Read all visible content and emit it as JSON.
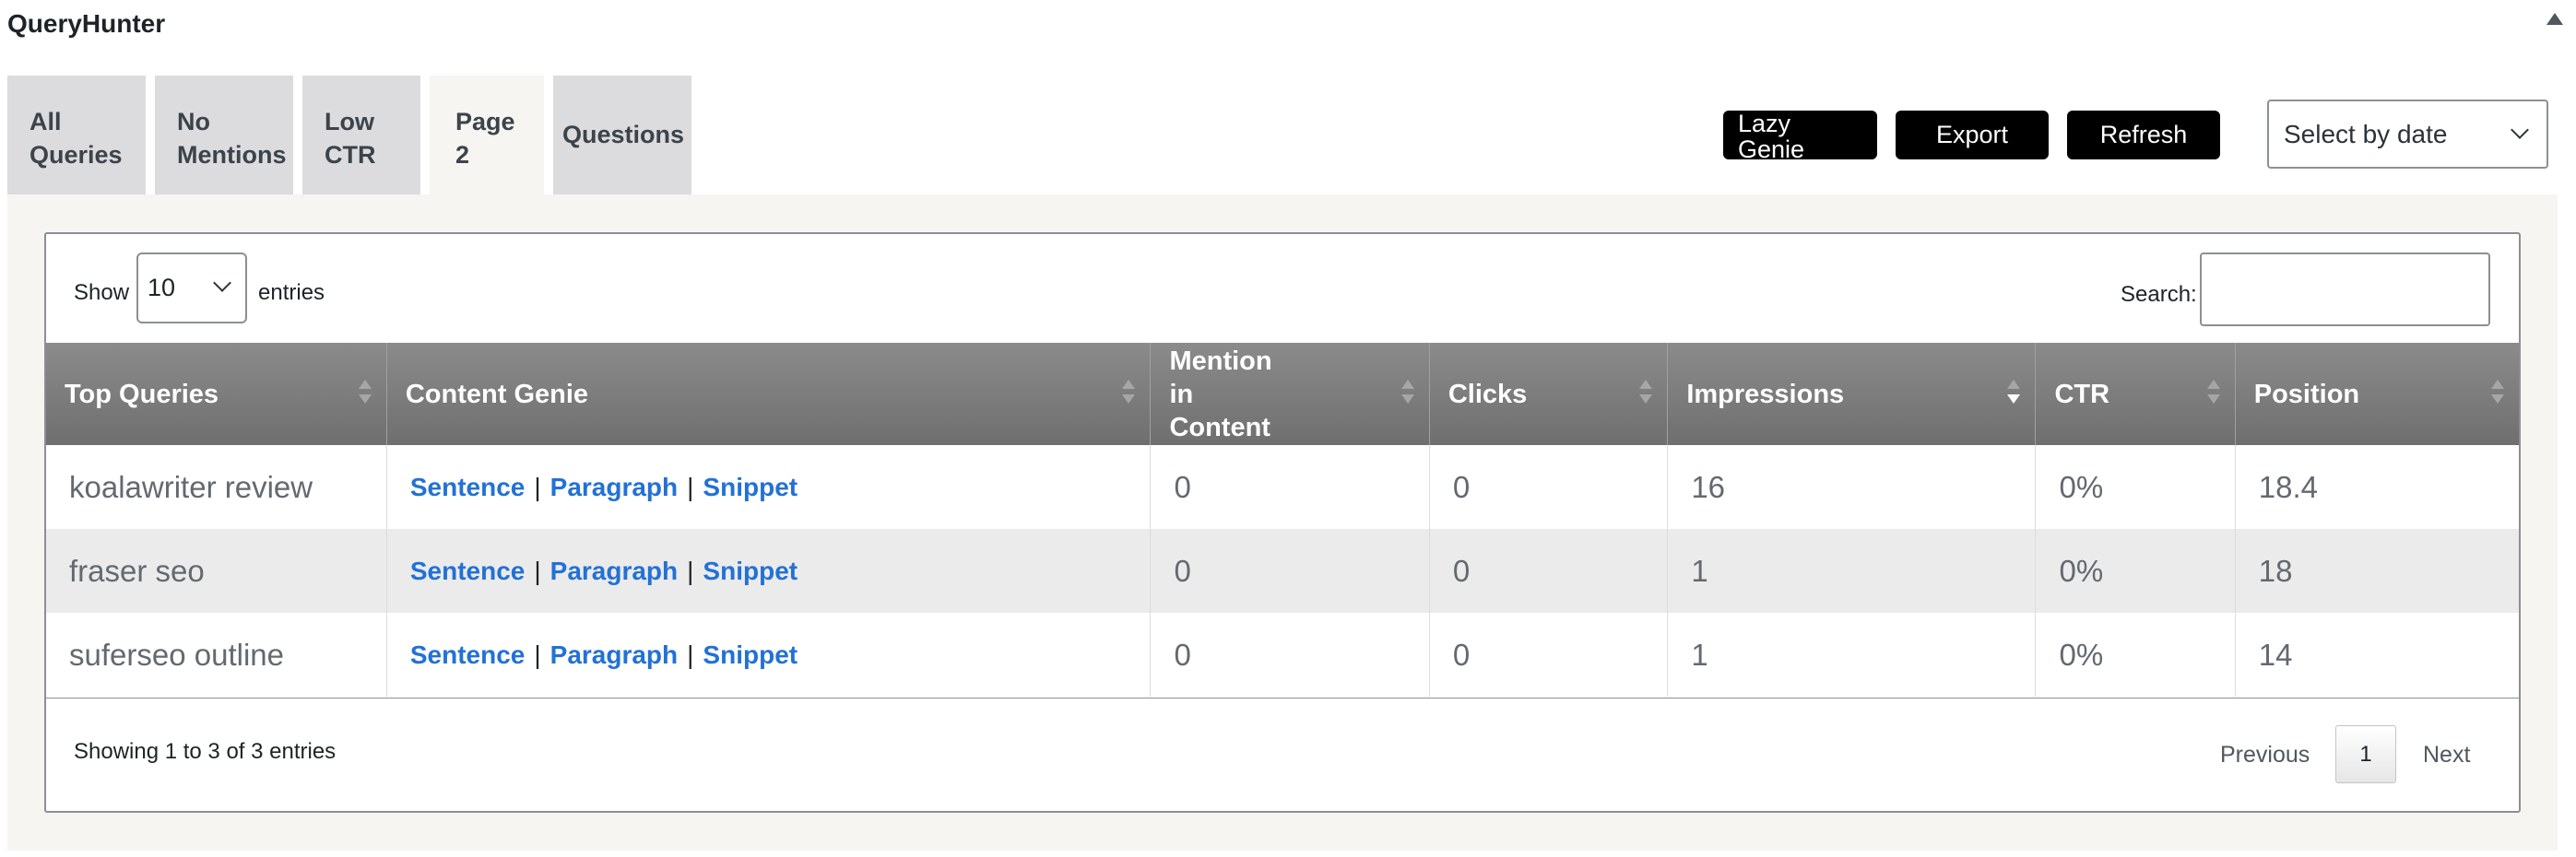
{
  "app": {
    "title": "QueryHunter"
  },
  "tabs": [
    {
      "label": "All Queries"
    },
    {
      "label": "No Mentions"
    },
    {
      "label": "Low CTR"
    },
    {
      "label": "Page 2",
      "active": true
    },
    {
      "label": "Questions"
    }
  ],
  "toolbar": {
    "lazy_genie_label": "Lazy Genie",
    "export_label": "Export",
    "refresh_label": "Refresh",
    "date_select_value": "Select by date"
  },
  "table_controls": {
    "show_label": "Show",
    "entries_value": "10",
    "entries_label": "entries",
    "search_label": "Search:",
    "search_value": ""
  },
  "columns": [
    "Top Queries",
    "Content Genie",
    "Mention in Content",
    "Clicks",
    "Impressions",
    "CTR",
    "Position"
  ],
  "rows": [
    {
      "query": "koalawriter review",
      "links": [
        "Sentence",
        "Paragraph",
        "Snippet"
      ],
      "mentions": "0",
      "clicks": "0",
      "impressions": "16",
      "ctr": "0%",
      "position": "18.4"
    },
    {
      "query": "fraser seo",
      "links": [
        "Sentence",
        "Paragraph",
        "Snippet"
      ],
      "mentions": "0",
      "clicks": "0",
      "impressions": "1",
      "ctr": "0%",
      "position": "18"
    },
    {
      "query": "suferseo outline",
      "links": [
        "Sentence",
        "Paragraph",
        "Snippet"
      ],
      "mentions": "0",
      "clicks": "0",
      "impressions": "1",
      "ctr": "0%",
      "position": "14"
    }
  ],
  "footer": {
    "info": "Showing 1 to 3 of 3 entries",
    "previous_label": "Previous",
    "current_page": "1",
    "next_label": "Next"
  },
  "colors": {
    "header_bg": "#7b7b7b",
    "link": "#2271d6",
    "button_bg": "#000000",
    "panel_bg": "#f6f5f2"
  }
}
